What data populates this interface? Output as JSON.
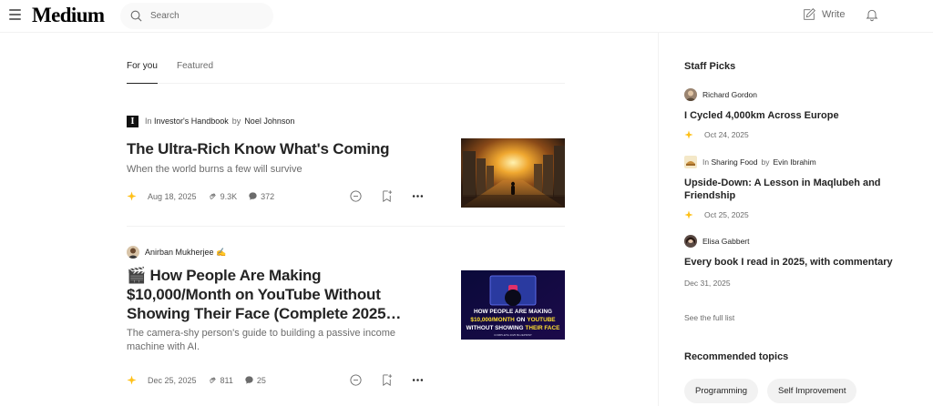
{
  "header": {
    "logo": "Medium",
    "search_placeholder": "Search",
    "write_label": "Write"
  },
  "tabs": [
    {
      "label": "For you",
      "active": true
    },
    {
      "label": "Featured",
      "active": false
    }
  ],
  "articles": [
    {
      "in_label": "In",
      "publication": "Investor's Handbook",
      "by_label": "by",
      "author": "Noel Johnson",
      "title": "The Ultra-Rich Know What's Coming",
      "subtitle": "When the world burns a few will survive",
      "date": "Aug 18, 2025",
      "claps": "9.3K",
      "comments": "372"
    },
    {
      "author": "Anirban Mukherjee ✍",
      "title": "🎬 How People Are Making $10,000/Month on YouTube Without Showing Their Face (Complete 2025…",
      "subtitle": "The camera-shy person's guide to building a passive income machine with AI.",
      "date": "Dec 25, 2025",
      "claps": "811",
      "comments": "25",
      "thumb_text": {
        "line1": "HOW PEOPLE ARE MAKING",
        "line2a": "$10,000/MONTH",
        "line2b": "ON",
        "line2c": "YOUTUBE",
        "line3a": "WITHOUT SHOWING",
        "line3b": "THEIR FACE",
        "line4": "COMPLETE 2025 BLUEPRINT"
      }
    }
  ],
  "sidebar": {
    "staff_picks_heading": "Staff Picks",
    "picks": [
      {
        "author": "Richard Gordon",
        "title": "I Cycled 4,000km Across Europe",
        "date": "Oct 24, 2025"
      },
      {
        "in_label": "In",
        "publication": "Sharing Food",
        "by_label": "by",
        "author": "Evin Ibrahim",
        "title": "Upside-Down: A Lesson in Maqlubeh and Friendship",
        "date": "Oct 25, 2025"
      },
      {
        "author": "Elisa Gabbert",
        "title": "Every book I read in 2025, with commentary",
        "date": "Dec 31, 2025"
      }
    ],
    "see_full_list": "See the full list",
    "recommended_heading": "Recommended topics",
    "topics": [
      "Programming",
      "Self Improvement"
    ]
  },
  "colors": {
    "sparkle": "#ffc017",
    "text_primary": "#242424",
    "text_secondary": "#6b6b6b"
  }
}
